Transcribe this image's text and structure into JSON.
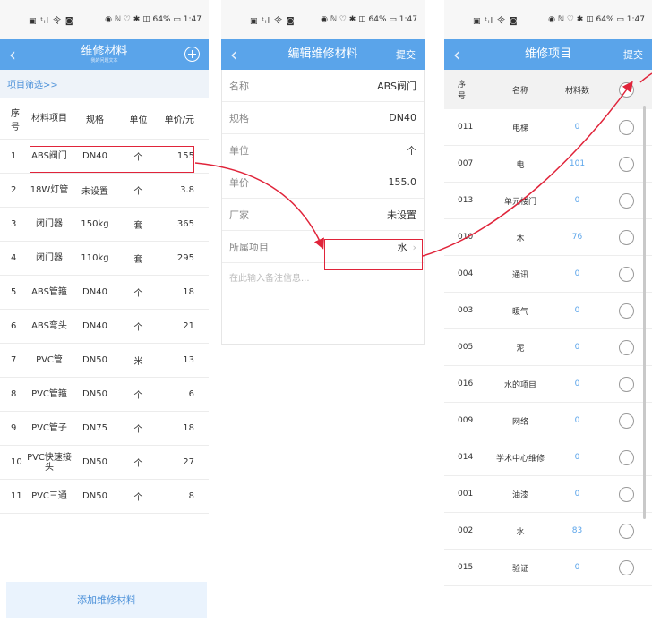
{
  "status": {
    "left": "▣ ᵗᵢl 令 ◙",
    "right_p1": "◉ ℕ ♡ ✱ ◫ 64% ▭ 1:47",
    "right_p2": "◉ ℕ ♡ ✱ ◫ 64% ▭ 1:47",
    "right_p3": "◉ ℕ ♡ ✱ ◫ 64% ▭ 1:47"
  },
  "screen1": {
    "title": "维修材料",
    "subtitle": "我的问题文本",
    "back": "‹",
    "filter": "项目筛选>>",
    "headers": [
      "序号",
      "材料项目",
      "规格",
      "单位",
      "单价/元"
    ],
    "rows": [
      [
        "1",
        "ABS阀门",
        "DN40",
        "个",
        "155"
      ],
      [
        "2",
        "18W灯管",
        "未设置",
        "个",
        "3.8"
      ],
      [
        "3",
        "闭门器",
        "150kg",
        "套",
        "365"
      ],
      [
        "4",
        "闭门器",
        "110kg",
        "套",
        "295"
      ],
      [
        "5",
        "ABS管箍",
        "DN40",
        "个",
        "18"
      ],
      [
        "6",
        "ABS弯头",
        "DN40",
        "个",
        "21"
      ],
      [
        "7",
        "PVC管",
        "DN50",
        "米",
        "13"
      ],
      [
        "8",
        "PVC管箍",
        "DN50",
        "个",
        "6"
      ],
      [
        "9",
        "PVC管子",
        "DN75",
        "个",
        "18"
      ],
      [
        "10",
        "PVC快速接头",
        "DN50",
        "个",
        "27"
      ],
      [
        "11",
        "PVC三通",
        "DN50",
        "个",
        "8"
      ]
    ],
    "add_button": "添加维修材料"
  },
  "screen2": {
    "title": "编辑维修材料",
    "back": "‹",
    "submit": "提交",
    "fields": [
      {
        "label": "名称",
        "value": "ABS阀门"
      },
      {
        "label": "规格",
        "value": "DN40"
      },
      {
        "label": "单位",
        "value": "个"
      },
      {
        "label": "单价",
        "value": "155.0"
      },
      {
        "label": "厂家",
        "value": "未设置"
      },
      {
        "label": "所属项目",
        "value": "水"
      }
    ],
    "chevron": "›",
    "remark_placeholder": "在此输入备注信息..."
  },
  "screen3": {
    "title": "维修项目",
    "back": "‹",
    "submit": "提交",
    "headers": [
      "序号",
      "名称",
      "材料数"
    ],
    "rows": [
      [
        "011",
        "电梯",
        "0"
      ],
      [
        "007",
        "电",
        "101"
      ],
      [
        "013",
        "单元楼门",
        "0"
      ],
      [
        "010",
        "木",
        "76"
      ],
      [
        "004",
        "通讯",
        "0"
      ],
      [
        "003",
        "暖气",
        "0"
      ],
      [
        "005",
        "泥",
        "0"
      ],
      [
        "016",
        "水的项目",
        "0"
      ],
      [
        "009",
        "网络",
        "0"
      ],
      [
        "014",
        "学术中心维修",
        "0"
      ],
      [
        "001",
        "油漆",
        "0"
      ],
      [
        "002",
        "水",
        "83"
      ],
      [
        "015",
        "验证",
        "0"
      ]
    ]
  },
  "colors": {
    "nav": "#5aa4ea",
    "highlight": "#e0243a",
    "link": "#4a90d9"
  }
}
